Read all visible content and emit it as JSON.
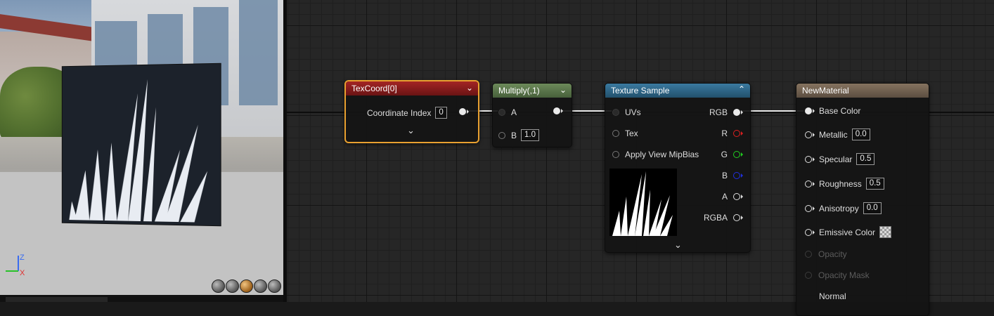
{
  "viewport": {
    "axis": {
      "z": "Z",
      "x": "X"
    },
    "view_modes": [
      "lit-sphere",
      "unlit-sphere",
      "material-sphere",
      "plane",
      "teapot"
    ]
  },
  "nodes": {
    "texcoord": {
      "title": "TexCoord[0]",
      "coordinate_label": "Coordinate Index",
      "coordinate_value": "0",
      "header_color": "#8c1c1c"
    },
    "multiply": {
      "title": "Multiply(,1)",
      "input_a": "A",
      "input_b": "B",
      "b_value": "1.0",
      "header_color": "#5f7a4e"
    },
    "texture_sample": {
      "title": "Texture Sample",
      "header_color": "#2e6688",
      "inputs": [
        "UVs",
        "Tex",
        "Apply View MipBias"
      ],
      "outputs": [
        "RGB",
        "R",
        "G",
        "B",
        "A",
        "RGBA"
      ]
    },
    "new_material": {
      "title": "NewMaterial",
      "header_color": "#6e5e4e",
      "base_color": "Base Color",
      "metallic": "Metallic",
      "metallic_value": "0.0",
      "specular": "Specular",
      "specular_value": "0.5",
      "roughness": "Roughness",
      "roughness_value": "0.5",
      "anisotropy": "Anisotropy",
      "anisotropy_value": "0.0",
      "emissive": "Emissive Color",
      "opacity": "Opacity",
      "opacity_mask": "Opacity Mask",
      "normal": "Normal"
    }
  }
}
